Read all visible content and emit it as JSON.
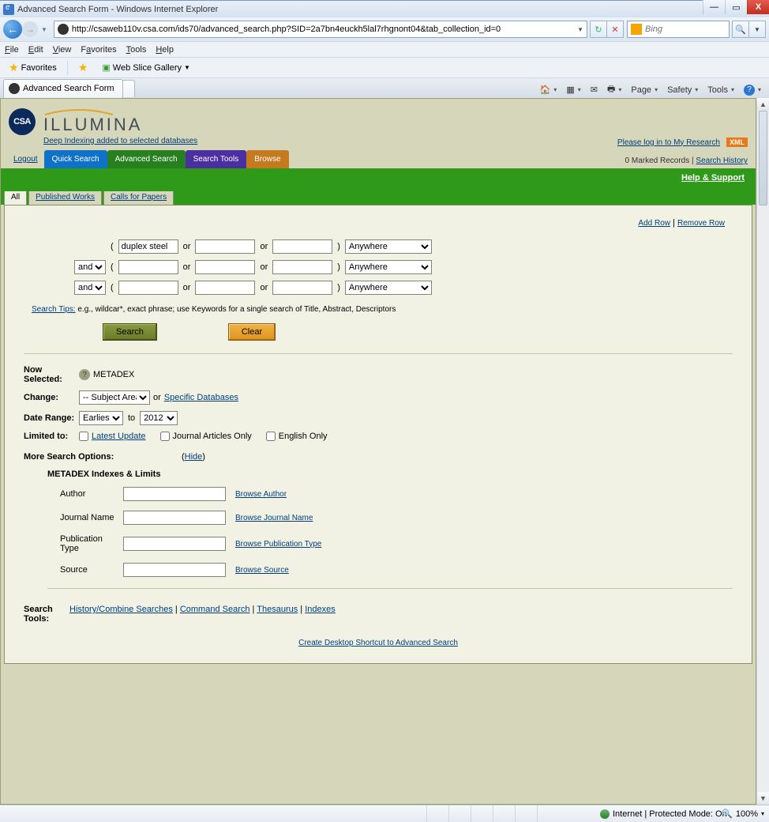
{
  "window": {
    "title": "Advanced Search Form - Windows Internet Explorer",
    "min": "—",
    "max": "▭",
    "close": "X"
  },
  "address": {
    "url": "http://csaweb110v.csa.com/ids70/advanced_search.php?SID=2a7bn4euckh5lal7rhgnont04&tab_collection_id=0",
    "refresh_tip": "↻",
    "stop_tip": "✕",
    "search_engine": "Bing",
    "search_icon": "🔍"
  },
  "menubar": {
    "file": "File",
    "edit": "Edit",
    "view": "View",
    "favorites": "Favorites",
    "tools": "Tools",
    "help": "Help"
  },
  "favbar": {
    "favorites": "Favorites",
    "webslice": "Web Slice Gallery"
  },
  "tab": {
    "title": "Advanced Search Form"
  },
  "cmdbar": {
    "page": "Page",
    "safety": "Safety",
    "tools": "Tools"
  },
  "brand": {
    "csa": "CSA",
    "illumina": "ILLUMINA",
    "deep": "Deep Indexing added to selected databases"
  },
  "topright": {
    "login": "Please log in to My Research",
    "xml": "XML"
  },
  "nav": {
    "logout": "Logout",
    "quick": "Quick Search",
    "adv": "Advanced Search",
    "stools": "Search Tools",
    "browse": "Browse",
    "marked": "0 Marked Records",
    "history": "Search History",
    "sep": " | "
  },
  "greenbar": {
    "help": "Help & Support"
  },
  "subtabs": {
    "all": "All",
    "pub": "Published Works",
    "cfp": "Calls for Papers"
  },
  "rowlinks": {
    "add": "Add Row",
    "remove": "Remove Row",
    "sep": " | "
  },
  "searchgrid": {
    "q1": "duplex steel",
    "or": "or",
    "and": "and",
    "anywhere": "Anywhere"
  },
  "tips": {
    "label": "Search Tips:",
    "text": " e.g., wildcar*, exact phrase; use Keywords for a single search of Title, Abstract, Descriptors"
  },
  "buttons": {
    "search": "Search",
    "clear": "Clear"
  },
  "meta": {
    "now_selected_lbl": "Now Selected:",
    "now_selected_val": "METADEX",
    "change_lbl": "Change:",
    "subject_area": "-- Subject Area --",
    "or": " or ",
    "specific": "Specific Databases",
    "date_range_lbl": "Date Range:",
    "earliest": "Earliest",
    "to": "to",
    "year": "2012",
    "limited_lbl": "Limited to:",
    "latest": "Latest Update",
    "journal": "Journal Articles Only",
    "english": "English Only",
    "more_opts": "More Search Options:",
    "hide": "Hide"
  },
  "indexes": {
    "header": "METADEX Indexes & Limits",
    "rows": [
      {
        "label": "Author",
        "browse": "Browse Author"
      },
      {
        "label": "Journal Name",
        "browse": "Browse Journal Name"
      },
      {
        "label": "Publication Type",
        "browse": "Browse Publication Type"
      },
      {
        "label": "Source",
        "browse": "Browse Source"
      }
    ]
  },
  "stools": {
    "lbl": "Search Tools:",
    "links": [
      "History/Combine Searches",
      "Command Search",
      "Thesaurus",
      "Indexes"
    ],
    "sep": " | "
  },
  "shortcut": {
    "text": "Create Desktop Shortcut to Advanced Search"
  },
  "status": {
    "mode": "Internet | Protected Mode: On",
    "zoom": "100%",
    "zoomdd": "▾"
  }
}
